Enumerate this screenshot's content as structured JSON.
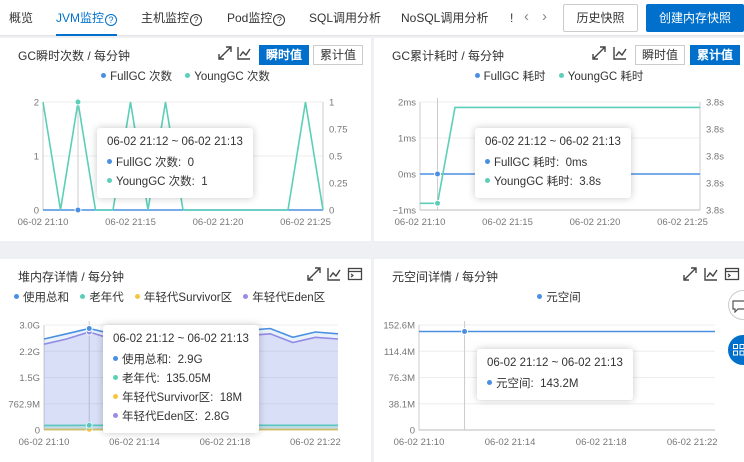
{
  "tabs": [
    {
      "label": "概览",
      "active": false
    },
    {
      "label": "JVM监控",
      "active": true,
      "help": true
    },
    {
      "label": "主机监控",
      "active": false,
      "help": true
    },
    {
      "label": "Pod监控",
      "active": false,
      "help": true
    },
    {
      "label": "SQL调用分析",
      "active": false
    },
    {
      "label": "NoSQL调用分析",
      "active": false
    },
    {
      "label": "!",
      "active": false
    }
  ],
  "nav": {
    "prev": "‹",
    "next": "›"
  },
  "help_icon": "?",
  "buttons": {
    "history": "历史快照",
    "create": "创建内存快照"
  },
  "colors": {
    "blue": "#4a90e2",
    "teal": "#5ccfb9",
    "yellow": "#f5c542",
    "purple": "#9b8ae6",
    "primary": "#0070cc"
  },
  "panels": {
    "gc_count": {
      "title": "GC瞬时次数 / 每分钟",
      "btn_instant": "瞬时值",
      "btn_cumulative": "累计值",
      "active": "instant",
      "legend": [
        "FullGC 次数",
        "YoungGC 次数"
      ],
      "tooltip": {
        "time": "06-02 21:12 ~ 06-02 21:13",
        "rows": [
          {
            "label": "FullGC 次数:",
            "value": "0"
          },
          {
            "label": "YoungGC 次数:",
            "value": "1"
          }
        ]
      }
    },
    "gc_time": {
      "title": "GC累计耗时 / 每分钟",
      "btn_instant": "瞬时值",
      "btn_cumulative": "累计值",
      "active": "cumulative",
      "legend": [
        "FullGC 耗时",
        "YoungGC 耗时"
      ],
      "tooltip": {
        "time": "06-02 21:12 ~ 06-02 21:13",
        "rows": [
          {
            "label": "FullGC 耗时:",
            "value": "0ms"
          },
          {
            "label": "YoungGC 耗时:",
            "value": "3.8s"
          }
        ]
      }
    },
    "heap": {
      "title": "堆内存详情 / 每分钟",
      "legend": [
        "使用总和",
        "老年代",
        "年轻代Survivor区",
        "年轻代Eden区"
      ],
      "tooltip": {
        "time": "06-02 21:12 ~ 06-02 21:13",
        "rows": [
          {
            "label": "使用总和:",
            "value": "2.9G"
          },
          {
            "label": "老年代:",
            "value": "135.05M"
          },
          {
            "label": "年轻代Survivor区:",
            "value": "18M"
          },
          {
            "label": "年轻代Eden区:",
            "value": "2.8G"
          }
        ]
      }
    },
    "meta": {
      "title": "元空间详情 / 每分钟",
      "legend": [
        "元空间"
      ],
      "tooltip": {
        "time": "06-02 21:12 ~ 06-02 21:13",
        "rows": [
          {
            "label": "元空间:",
            "value": "143.2M"
          }
        ]
      }
    }
  },
  "chart_data": [
    {
      "type": "line",
      "title": "GC瞬时次数 / 每分钟",
      "x": [
        "06-02 21:10",
        "06-02 21:11",
        "06-02 21:12",
        "06-02 21:13",
        "06-02 21:14",
        "06-02 21:15",
        "06-02 21:16",
        "06-02 21:17",
        "06-02 21:18",
        "06-02 21:19",
        "06-02 21:20",
        "06-02 21:21",
        "06-02 21:22",
        "06-02 21:23",
        "06-02 21:24",
        "06-02 21:25",
        "06-02 21:26"
      ],
      "x_ticks": [
        "06-02 21:10",
        "06-02 21:15",
        "06-02 21:20",
        "06-02 21:25"
      ],
      "y_left_ticks": [
        "0",
        "1",
        "2"
      ],
      "y_right_ticks": [
        "0",
        "0.25",
        "0.5",
        "0.75",
        "1"
      ],
      "ylim_left": [
        0,
        2
      ],
      "ylim_right": [
        0,
        1
      ],
      "series": [
        {
          "name": "FullGC 次数",
          "axis": "left",
          "values": [
            0,
            0,
            0,
            0,
            0,
            0,
            0,
            0,
            0,
            0,
            0,
            0,
            0,
            0,
            0,
            0,
            0
          ]
        },
        {
          "name": "YoungGC 次数",
          "axis": "right",
          "values": [
            1,
            0,
            1,
            0,
            0,
            1,
            0,
            1,
            0,
            0,
            0,
            0,
            0,
            0,
            0,
            1,
            0
          ]
        }
      ]
    },
    {
      "type": "line",
      "title": "GC累计耗时 / 每分钟",
      "x": [
        "06-02 21:10",
        "06-02 21:11",
        "06-02 21:12",
        "06-02 21:13",
        "06-02 21:14",
        "06-02 21:15",
        "06-02 21:16",
        "06-02 21:17",
        "06-02 21:18",
        "06-02 21:19",
        "06-02 21:20",
        "06-02 21:21",
        "06-02 21:22",
        "06-02 21:23",
        "06-02 21:24",
        "06-02 21:25",
        "06-02 21:26"
      ],
      "x_ticks": [
        "06-02 21:10",
        "06-02 21:15",
        "06-02 21:20",
        "06-02 21:25"
      ],
      "y_left_ticks": [
        "−1ms",
        "0ms",
        "1ms",
        "2ms"
      ],
      "y_right_ticks": [
        "3.8s",
        "3.8s",
        "3.8s",
        "3.8s",
        "3.8s"
      ],
      "ylim_left": [
        -1,
        2
      ],
      "ylim_right": [
        0,
        4
      ],
      "series": [
        {
          "name": "FullGC 耗时",
          "axis": "left",
          "values": [
            0,
            0,
            0,
            0,
            0,
            0,
            0,
            0,
            0,
            0,
            0,
            0,
            0,
            0,
            0,
            0,
            0
          ]
        },
        {
          "name": "YoungGC 耗时",
          "axis": "right",
          "values": [
            0.25,
            0.25,
            3.8,
            3.8,
            3.8,
            3.8,
            3.8,
            3.8,
            3.8,
            3.8,
            3.8,
            3.8,
            3.8,
            3.8,
            3.8,
            3.8,
            3.8
          ]
        }
      ]
    },
    {
      "type": "area",
      "title": "堆内存详情 / 每分钟",
      "x": [
        "06-02 21:10",
        "06-02 21:11",
        "06-02 21:12",
        "06-02 21:13",
        "06-02 21:14",
        "06-02 21:15",
        "06-02 21:16",
        "06-02 21:17",
        "06-02 21:18",
        "06-02 21:19",
        "06-02 21:20",
        "06-02 21:21",
        "06-02 21:22",
        "06-02 21:23"
      ],
      "x_ticks": [
        "06-02 21:10",
        "06-02 21:14",
        "06-02 21:18",
        "06-02 21:22"
      ],
      "y_ticks": [
        "0",
        "762.9M",
        "1.5G",
        "2.2G",
        "3.0G"
      ],
      "ylim": [
        0,
        3.0
      ],
      "unit": "G",
      "series": [
        {
          "name": "使用总和",
          "values": [
            2.6,
            2.75,
            2.9,
            2.75,
            2.85,
            2.65,
            2.8,
            2.9,
            2.6,
            2.85,
            2.9,
            2.65,
            2.8,
            2.75
          ]
        },
        {
          "name": "老年代",
          "values": [
            0.13,
            0.13,
            0.135,
            0.135,
            0.135,
            0.135,
            0.135,
            0.135,
            0.135,
            0.135,
            0.135,
            0.135,
            0.135,
            0.135
          ]
        },
        {
          "name": "年轻代Survivor区",
          "values": [
            0.018,
            0.018,
            0.018,
            0.018,
            0.018,
            0.018,
            0.018,
            0.018,
            0.018,
            0.018,
            0.018,
            0.018,
            0.018,
            0.018
          ]
        },
        {
          "name": "年轻代Eden区",
          "values": [
            2.45,
            2.6,
            2.8,
            2.6,
            2.7,
            2.5,
            2.65,
            2.75,
            2.45,
            2.7,
            2.75,
            2.5,
            2.65,
            2.6
          ]
        }
      ]
    },
    {
      "type": "line",
      "title": "元空间详情 / 每分钟",
      "x": [
        "06-02 21:10",
        "06-02 21:11",
        "06-02 21:12",
        "06-02 21:13",
        "06-02 21:14",
        "06-02 21:15",
        "06-02 21:16",
        "06-02 21:17",
        "06-02 21:18",
        "06-02 21:19",
        "06-02 21:20",
        "06-02 21:21",
        "06-02 21:22",
        "06-02 21:23"
      ],
      "x_ticks": [
        "06-02 21:10",
        "06-02 21:14",
        "06-02 21:18",
        "06-02 21:22"
      ],
      "y_ticks": [
        "0",
        "38.1M",
        "76.3M",
        "114.4M",
        "152.6M"
      ],
      "ylim": [
        0,
        152.6
      ],
      "unit": "M",
      "series": [
        {
          "name": "元空间",
          "values": [
            143.2,
            143.2,
            143.2,
            143.2,
            143.2,
            143.2,
            143.2,
            143.2,
            143.2,
            143.2,
            143.2,
            143.2,
            143.2,
            143.2
          ]
        }
      ]
    }
  ]
}
